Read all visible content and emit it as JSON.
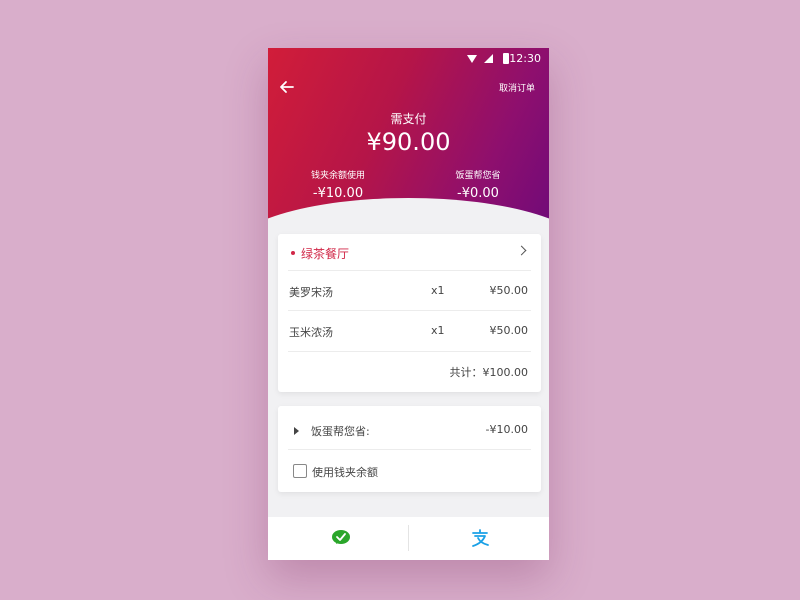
{
  "status": {
    "time": "12:30"
  },
  "header": {
    "cancel_label": "取消订单",
    "pay_title": "需支付",
    "pay_amount": "¥90.00",
    "wallet_label": "钱夹余额使用",
    "wallet_value": "-¥10.00",
    "fandan_label": "饭蛋帮您省",
    "fandan_value": "-¥0.00"
  },
  "order": {
    "restaurant": "绿茶餐厅",
    "items": [
      {
        "name": "美罗宋汤",
        "qty": "x1",
        "price": "¥50.00"
      },
      {
        "name": "玉米浓汤",
        "qty": "x1",
        "price": "¥50.00"
      }
    ],
    "total": "共计：¥100.00"
  },
  "discount": {
    "save_label": "饭蛋帮您省:",
    "save_value": "-¥10.00",
    "wallet_option": "使用钱夹余额"
  },
  "payment": {
    "wechat_icon": "wechat-pay-icon",
    "alipay_icon": "alipay-icon",
    "colors": {
      "wechat": "#2aa62a",
      "alipay": "#1aa0e6",
      "accent": "#d12747"
    }
  }
}
